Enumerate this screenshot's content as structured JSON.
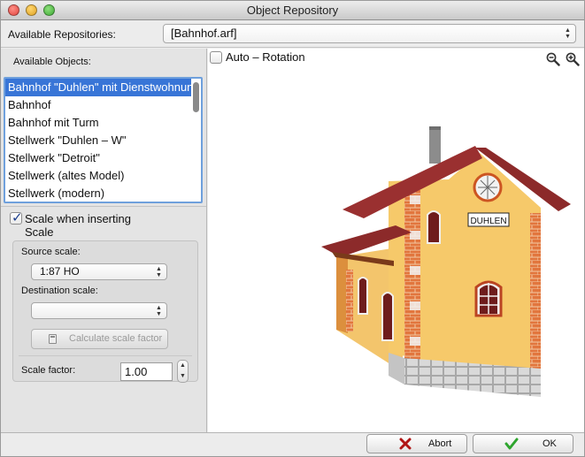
{
  "window": {
    "title": "Object Repository"
  },
  "repository": {
    "label": "Available Repositories:",
    "selected": "[Bahnhof.arf]"
  },
  "objects": {
    "label": "Available Objects:",
    "items": [
      "Bahnhof \"Duhlen\" mit Dienstwohnung",
      "Bahnhof",
      "Bahnhof mit Turm",
      "Stellwerk \"Duhlen – W\"",
      "Stellwerk \"Detroit\"",
      "Stellwerk (altes Model)",
      "Stellwerk (modern)"
    ],
    "selected_index": 0
  },
  "scaling": {
    "checkbox_label_line1": "Scale when inserting",
    "checkbox_label_line2": "Scale",
    "checked": true,
    "source_label": "Source scale:",
    "source_value": "1:87 HO",
    "destination_label": "Destination scale:",
    "destination_value": "",
    "calc_button_label": "Calculate scale factor",
    "factor_label": "Scale factor:",
    "factor_value": "1.00"
  },
  "preview": {
    "auto_rotation_label": "Auto – Rotation",
    "auto_rotation_checked": false,
    "sign_text": "DUHLEN",
    "icons": [
      "zoom-out-icon",
      "zoom-in-icon"
    ]
  },
  "buttons": {
    "abort_label": "Abort",
    "ok_label": "OK"
  },
  "colors": {
    "selection": "#3875d7",
    "wall": "#f6c96a",
    "roof": "#8c2a2a",
    "brick": "#dd6633",
    "ok_check": "#2ea52e",
    "abort_x": "#b01515"
  }
}
